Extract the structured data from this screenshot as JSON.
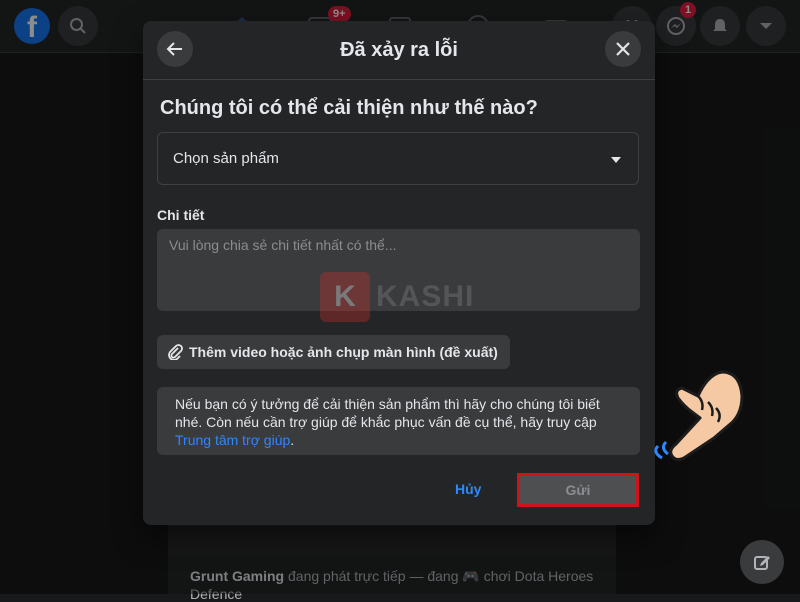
{
  "topbar": {
    "logo_letter": "f",
    "badges": {
      "notifications": "9+",
      "messenger": "1"
    }
  },
  "modal": {
    "title": "Đã xảy ra lỗi",
    "question": "Chúng tôi có thể cải thiện như thế nào?",
    "product_select": {
      "value": "Chọn sản phẩm"
    },
    "details_label": "Chi tiết",
    "details_placeholder": "Vui lòng chia sẻ chi tiết nhất có thể...",
    "attach_label": "Thêm video hoặc ảnh chụp màn hình (đề xuất)",
    "info_text": "Nếu bạn có ý tưởng để cải thiện sản phẩm thì hãy cho chúng tôi biết nhé. Còn nếu cần trợ giúp để khắc phục vấn đề cụ thể, hãy truy cập",
    "info_link": "Trung tâm trợ giúp",
    "info_end": ".",
    "cancel_label": "Hủy",
    "submit_label": "Gửi"
  },
  "watermark": {
    "letter": "K",
    "text": "KASHI"
  },
  "feed": {
    "author": "Grunt Gaming",
    "activity": "đang phát trực tiếp — đang 🎮 chơi Dota Heroes",
    "activity_line2": "Defence"
  },
  "colors": {
    "accent": "#2d88ff",
    "highlight_border": "#d0121b",
    "modal_bg": "#242526",
    "page_bg": "#18191a"
  }
}
